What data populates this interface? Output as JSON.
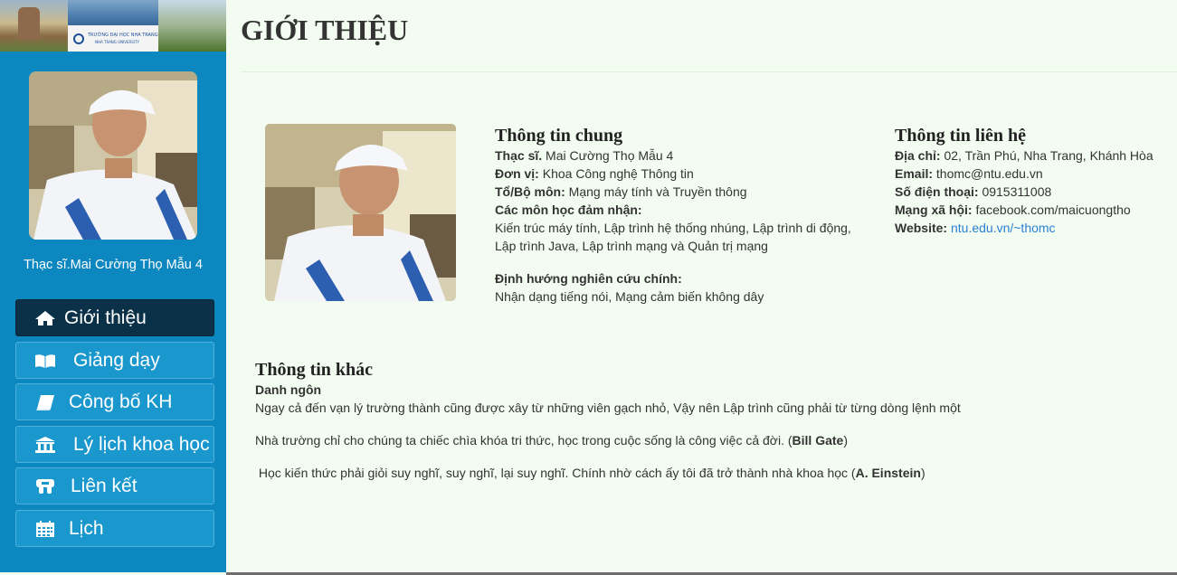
{
  "banner": {
    "line1": "TRƯỜNG ĐẠI HỌC NHA TRANG",
    "line2": "NHA TRANG UNIVERSITY"
  },
  "sidebar": {
    "name": "Thạc sĩ.Mai Cường Thọ Mẫu 4",
    "items": [
      {
        "label": "Giới thiệu",
        "icon": "home-icon",
        "active": true
      },
      {
        "label": "Giảng dạy",
        "icon": "book-open-icon"
      },
      {
        "label": "Công bố KH",
        "icon": "book-icon"
      },
      {
        "label": "Lý lịch khoa học",
        "icon": "institution-icon"
      },
      {
        "label": "Liên kết",
        "icon": "link-group-icon"
      },
      {
        "label": "Lịch",
        "icon": "calendar-icon"
      }
    ]
  },
  "page": {
    "title": "GIỚI THIỆU"
  },
  "general": {
    "heading": "Thông tin chung",
    "degree_label": "Thạc sĩ.",
    "degree_value": "Mai Cường Thọ Mẫu 4",
    "unit_label": "Đơn vị:",
    "unit_value": "Khoa Công nghệ Thông tin",
    "dept_label": "Tổ/Bộ môn:",
    "dept_value": "Mạng máy tính và Truyền thông",
    "courses_label": "Các môn học đảm nhận:",
    "courses_line1": "Kiến trúc máy tính, Lập trình hệ thống nhúng, Lập trình di động,",
    "courses_line2": "Lập trình Java, Lập trình mạng và Quản trị mạng",
    "research_label": "Định hướng nghiên cứu chính:",
    "research_value": "Nhận dạng tiếng nói, Mạng cảm biến không dây"
  },
  "contact": {
    "heading": "Thông tin liên hệ",
    "address_label": "Địa chỉ:",
    "address_value": "02, Trần Phú, Nha Trang, Khánh Hòa",
    "email_label": "Email:",
    "email_value": "thomc@ntu.edu.vn",
    "phone_label": "Số điện thoại:",
    "phone_value": "0915311008",
    "social_label": "Mạng xã hội:",
    "social_value": "facebook.com/maicuongtho",
    "website_label": "Website:",
    "website_value": "ntu.edu.vn/~thomc"
  },
  "other": {
    "heading": "Thông tin khác",
    "quotes_label": "Danh ngôn",
    "quote1": "Ngay cả đến vạn lý trường thành cũng được xây từ những viên gạch nhỏ, Vậy nên Lập trình cũng phải từ từng dòng lệnh một",
    "quote2_text": "Nhà trường chỉ cho chúng ta chiếc chìa khóa tri thức, học trong cuộc sống là công việc cả đời. (",
    "quote2_author": "Bill Gate",
    "quote2_end": ")",
    "quote3_text": " Học kiến thức phải giỏi suy nghĩ, suy nghĩ, lại suy nghĩ. Chính nhờ cách ấy tôi đã trở thành nhà khoa học (",
    "quote3_author": "A. Einstein",
    "quote3_end": ")"
  }
}
